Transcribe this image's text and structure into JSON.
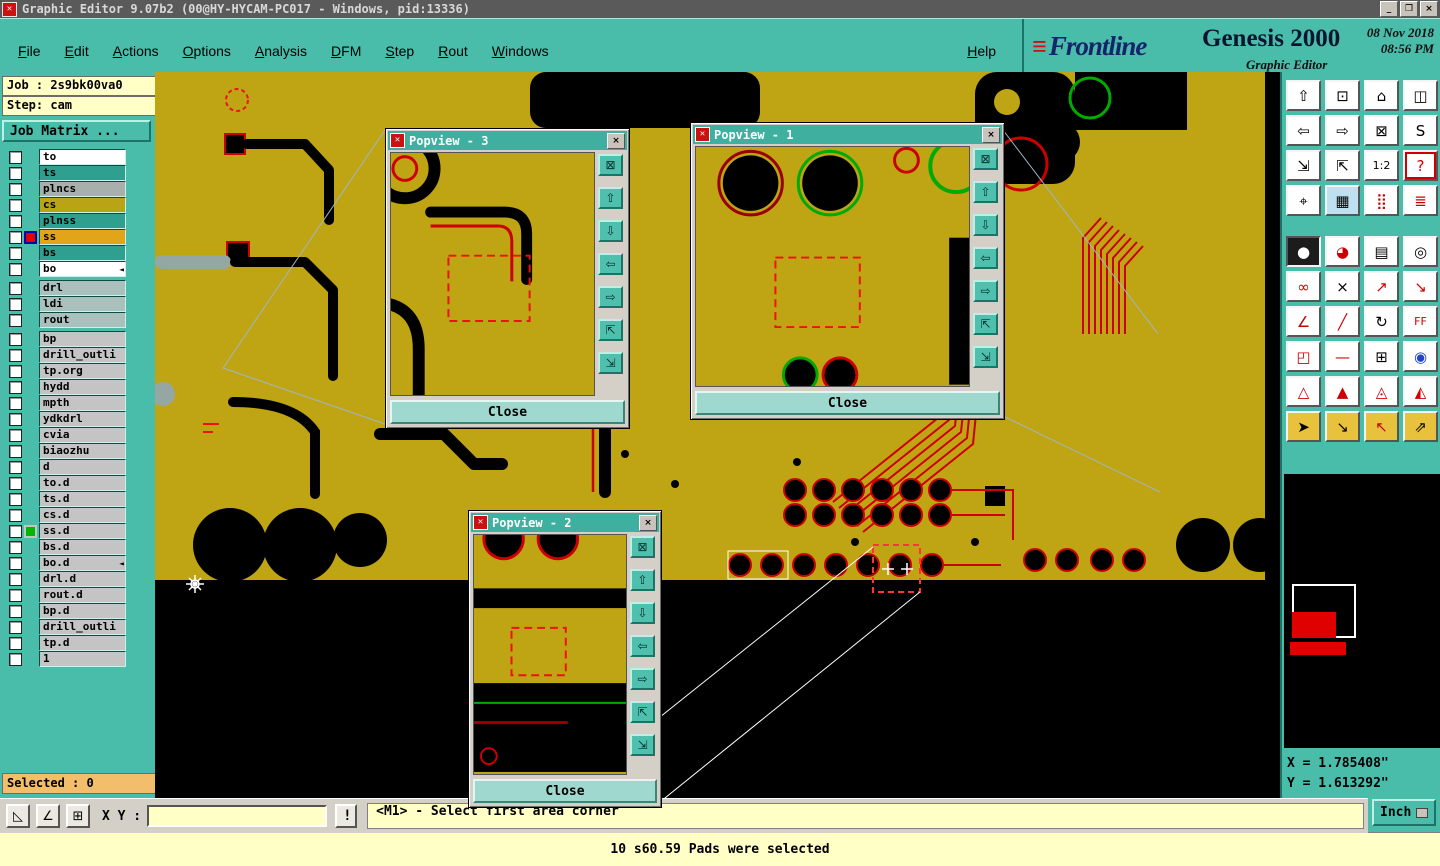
{
  "window": {
    "title": "Graphic Editor 9.07b2 (00@HY-HYCAM-PC017 - Windows, pid:13336)",
    "app_icon_glyph": "✕",
    "minimize_glyph": "_",
    "maximize_glyph": "❐",
    "close_glyph": "×"
  },
  "menubar": {
    "items": [
      "File",
      "Edit",
      "Actions",
      "Options",
      "Analysis",
      "DFM",
      "Step",
      "Rout",
      "Windows"
    ],
    "help": "Help"
  },
  "branding": {
    "bars_glyph": "≡",
    "brand": "Frontline",
    "product": "Genesis 2000",
    "subtitle": "Graphic Editor",
    "date": "08 Nov 2018",
    "time": "08:56 PM"
  },
  "sidebar": {
    "job_label": "Job : 2s9bk00va0",
    "step_label": "Step: cam",
    "matrix_button": "Job Matrix ...",
    "selected_label": "Selected : 0",
    "layers": [
      {
        "name": "to",
        "color": "#ffffff"
      },
      {
        "name": "ts",
        "color": "#2fa08f"
      },
      {
        "name": "plncs",
        "color": "#a8b0ac"
      },
      {
        "name": "cs",
        "color": "#b8a414"
      },
      {
        "name": "plnss",
        "color": "#2fa08f"
      },
      {
        "name": "ss",
        "color": "#e2a51a",
        "marker": "#e00000",
        "marker_bg": "#0000a8"
      },
      {
        "name": "bs",
        "color": "#2fa08f"
      },
      {
        "name": "bo",
        "color": "#ffffff",
        "arrow": true
      },
      {
        "name": "drl",
        "color": "#a9c0bd",
        "gap_before": true
      },
      {
        "name": "ldi",
        "color": "#a9c0bd"
      },
      {
        "name": "rout",
        "color": "#a9c0bd"
      },
      {
        "name": "bp",
        "color": "#c4c4c4",
        "gap_before": true
      },
      {
        "name": "drill_outli",
        "color": "#c4c4c4"
      },
      {
        "name": "tp.org",
        "color": "#c4c4c4"
      },
      {
        "name": "hydd",
        "color": "#c4c4c4"
      },
      {
        "name": "mpth",
        "color": "#c4c4c4"
      },
      {
        "name": "ydkdrl",
        "color": "#c4c4c4"
      },
      {
        "name": "cvia",
        "color": "#c4c4c4"
      },
      {
        "name": "biaozhu",
        "color": "#c4c4c4"
      },
      {
        "name": "d",
        "color": "#c4c4c4"
      },
      {
        "name": "to.d",
        "color": "#c4c4c4"
      },
      {
        "name": "ts.d",
        "color": "#c4c4c4"
      },
      {
        "name": "cs.d",
        "color": "#c4c4c4"
      },
      {
        "name": "ss.d",
        "color": "#c4c4c4",
        "marker": "#00b800",
        "marker_bg": "#c4c4c4"
      },
      {
        "name": "bs.d",
        "color": "#c4c4c4"
      },
      {
        "name": "bo.d",
        "color": "#c4c4c4",
        "arrow": true
      },
      {
        "name": "drl.d",
        "color": "#c4c4c4"
      },
      {
        "name": "rout.d",
        "color": "#c4c4c4"
      },
      {
        "name": "bp.d",
        "color": "#c4c4c4"
      },
      {
        "name": "drill_outli",
        "color": "#c4c4c4"
      },
      {
        "name": "tp.d",
        "color": "#c4c4c4"
      },
      {
        "name": "1",
        "color": "#c4c4c4"
      }
    ]
  },
  "popviews": [
    {
      "title": "Popview - 3",
      "close_label": "Close"
    },
    {
      "title": "Popview - 1",
      "close_label": "Close"
    },
    {
      "title": "Popview - 2",
      "close_label": "Close"
    }
  ],
  "popview_buttons": [
    {
      "n": "zoom-window-icon",
      "g": "⊠"
    },
    {
      "n": "pan-up-icon",
      "g": "⇧"
    },
    {
      "n": "pan-down-icon",
      "g": "⇩"
    },
    {
      "n": "pan-left-icon",
      "g": "⇦"
    },
    {
      "n": "pan-right-icon",
      "g": "⇨"
    },
    {
      "n": "zoom-fit-icon",
      "g": "⇱"
    },
    {
      "n": "move-view-icon",
      "g": "⇲"
    }
  ],
  "right_toolbar": {
    "top_buttons": [
      {
        "n": "pan-up-button",
        "g": "⇧"
      },
      {
        "n": "screen-view-button",
        "g": "⊡"
      },
      {
        "n": "home-view-button",
        "g": "⌂"
      },
      {
        "n": "split-view-button",
        "g": "◫"
      },
      {
        "n": "pan-left-button",
        "g": "⇦"
      },
      {
        "n": "pan-right-button",
        "g": "⇨"
      },
      {
        "n": "zoom-window-button",
        "g": "⊠"
      },
      {
        "n": "serpentine-button",
        "g": "S"
      },
      {
        "n": "zoom-prev-button",
        "g": "⇲"
      },
      {
        "n": "zoom-fit-button",
        "g": "⇱"
      },
      {
        "n": "scale-1-2-button",
        "g": "1:2"
      },
      {
        "n": "help-button",
        "g": "?",
        "fg": "#cc0000",
        "bd": "#cc0000"
      },
      {
        "n": "center-view-button",
        "g": "⌖"
      },
      {
        "n": "grid-button",
        "g": "▦",
        "bg": "#BFE0EE"
      },
      {
        "n": "dots-pattern-button",
        "g": "⣿",
        "fg": "#cc0000"
      },
      {
        "n": "signal-layers-button",
        "g": "≣",
        "fg": "#cc0000"
      }
    ],
    "main_buttons": [
      {
        "n": "select-point-button",
        "g": "●",
        "pressed": true
      },
      {
        "n": "pie-measure-button",
        "g": "◕",
        "fg": "#cc0000"
      },
      {
        "n": "ruler-button",
        "g": "▤"
      },
      {
        "n": "target-button",
        "g": "◎"
      },
      {
        "n": "net-links-button",
        "g": "∞",
        "fg": "#cc0000"
      },
      {
        "n": "delete-button",
        "g": "×"
      },
      {
        "n": "vector-up-button",
        "g": "↗",
        "fg": "#cc0000"
      },
      {
        "n": "vector-down-button",
        "g": "↘",
        "fg": "#cc0000"
      },
      {
        "n": "angle-measure-button",
        "g": "∠",
        "fg": "#cc0000"
      },
      {
        "n": "line-draw-button",
        "g": "╱",
        "fg": "#cc0000"
      },
      {
        "n": "rotate-button",
        "g": "↻"
      },
      {
        "n": "mirror-button",
        "g": "FF",
        "fg": "#cc0000"
      },
      {
        "n": "overlap-shapes-button",
        "g": "◰",
        "fg": "#cc0000"
      },
      {
        "n": "dash-line-button",
        "g": "—",
        "fg": "#cc0000"
      },
      {
        "n": "fit-box-button",
        "g": "⊞"
      },
      {
        "n": "circles-button",
        "g": "◉",
        "fg": "#2244cc"
      },
      {
        "n": "triangle-outline-button",
        "g": "△",
        "fg": "#cc0000"
      },
      {
        "n": "triangle-fill-button",
        "g": "▲",
        "fg": "#cc0000"
      },
      {
        "n": "triangle-dot-button",
        "g": "◬",
        "fg": "#cc0000"
      },
      {
        "n": "triangle-mix-button",
        "g": "◭",
        "fg": "#cc0000"
      },
      {
        "n": "select-cursor-button",
        "g": "➤",
        "bg": "#E8C23C"
      },
      {
        "n": "select-inside-button",
        "g": "↘",
        "bg": "#E8C23C"
      },
      {
        "n": "select-touch-button",
        "g": "↖",
        "bg": "#E8C23C",
        "fg": "#cc0000"
      },
      {
        "n": "select-angle-button",
        "g": "⇗",
        "bg": "#E8C23C"
      }
    ]
  },
  "coords": {
    "x": "X = 1.785408\"",
    "y": "Y = 1.613292\""
  },
  "commandbar": {
    "tool_buttons": [
      {
        "n": "pointer-tool-button",
        "g": "◺"
      },
      {
        "n": "angle-tool-button",
        "g": "∠"
      },
      {
        "n": "grid-origin-button",
        "g": "⊞"
      }
    ],
    "xy_label": "X Y :",
    "input_value": "",
    "alert_button": "!",
    "prompt": "<M1> - Select first area corner",
    "units_button": "Inch"
  },
  "message_bar": "10 s60.59 Pads were selected",
  "colors": {
    "teal": "#49BCAA",
    "copper": "#BFA414",
    "accent_red": "#CC0000"
  }
}
